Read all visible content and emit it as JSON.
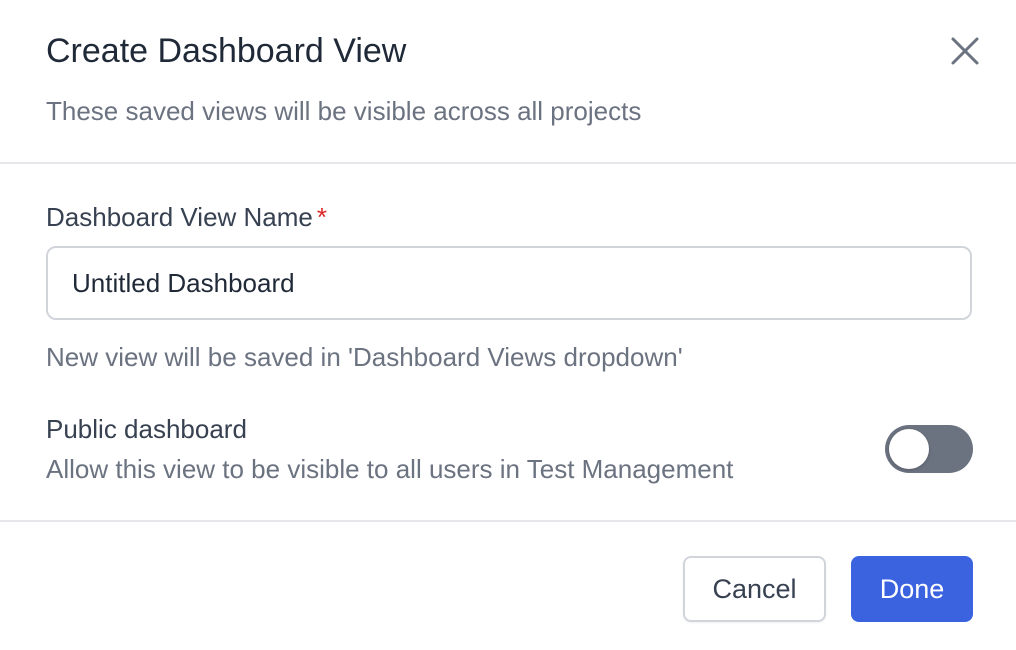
{
  "dialog": {
    "title": "Create Dashboard View",
    "subtitle": "These saved views will be visible across all projects",
    "close_icon": "close-icon"
  },
  "form": {
    "name_label": "Dashboard View Name",
    "required_marker": "*",
    "name_value": "Untitled Dashboard",
    "help_text": "New view will be saved in 'Dashboard Views dropdown'",
    "public_title": "Public dashboard",
    "public_description": "Allow this view to be visible to all users in Test Management",
    "public_enabled": false
  },
  "footer": {
    "cancel_label": "Cancel",
    "done_label": "Done"
  },
  "colors": {
    "primary": "#3b63e0",
    "required": "#dc2626",
    "toggle_off": "#6b7280"
  }
}
